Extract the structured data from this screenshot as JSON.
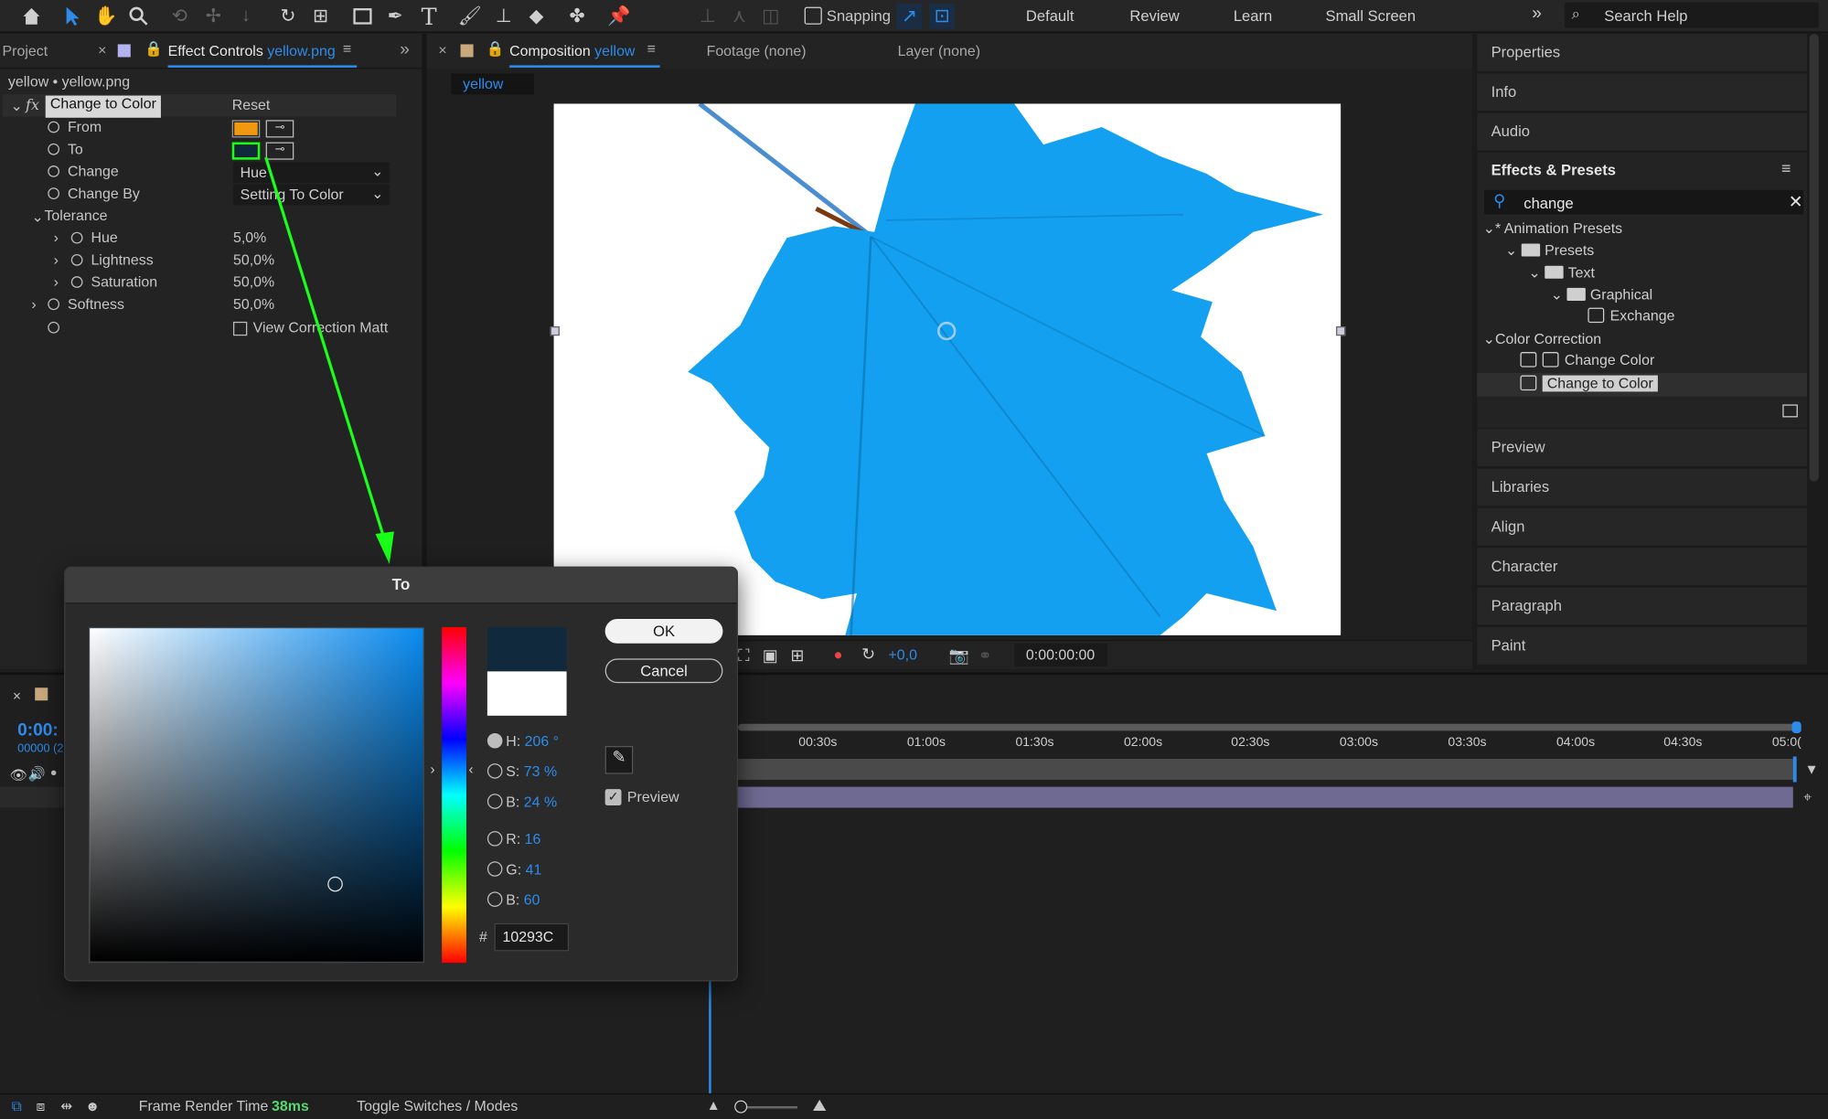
{
  "toolbar": {
    "snapping_label": "Snapping",
    "workspaces": [
      "Default",
      "Review",
      "Learn",
      "Small Screen"
    ],
    "more": "»",
    "search_placeholder": "Search Help"
  },
  "left_panel": {
    "tab_project": "Project",
    "tab_effect_controls": "Effect Controls",
    "tab_effect_file": "yellow.png",
    "breadcrumb": "yellow • yellow.png",
    "effect_name": "Change to Color",
    "reset": "Reset",
    "props": {
      "from": "From",
      "to": "To",
      "change": "Change",
      "change_value": "Hue",
      "change_by": "Change By",
      "change_by_value": "Setting To Color",
      "tolerance": "Tolerance",
      "hue": "Hue",
      "hue_value": "5,0%",
      "lightness": "Lightness",
      "lightness_value": "50,0%",
      "saturation": "Saturation",
      "saturation_value": "50,0%",
      "softness": "Softness",
      "softness_value": "50,0%",
      "view_correction": "View Correction Matt"
    },
    "colors": {
      "from": "#f0980f",
      "to": "#10293c"
    }
  },
  "comp_panel": {
    "tab_composition": "Composition",
    "tab_comp_name": "yellow",
    "tab_footage": "Footage (none)",
    "tab_layer": "Layer (none)",
    "comp_chip": "yellow",
    "exposure": "+0,0",
    "timecode": "0:00:00:00"
  },
  "right_panel": {
    "properties": "Properties",
    "info": "Info",
    "audio": "Audio",
    "effects_presets": "Effects & Presets",
    "search_value": "change",
    "tree": {
      "animation_presets": "* Animation Presets",
      "presets": "Presets",
      "text": "Text",
      "graphical": "Graphical",
      "exchange": "Exchange",
      "color_correction": "Color Correction",
      "change_color": "Change Color",
      "change_to_color": "Change to Color"
    },
    "collapsed": [
      "Preview",
      "Libraries",
      "Align",
      "Character",
      "Paragraph",
      "Paint"
    ]
  },
  "dialog": {
    "title": "To",
    "ok": "OK",
    "cancel": "Cancel",
    "preview": "Preview",
    "h_label": "H:",
    "h_value": "206",
    "h_unit": "°",
    "s_label": "S:",
    "s_value": "73",
    "s_unit": "%",
    "b_label": "B:",
    "b_value": "24",
    "b_unit": "%",
    "r_label": "R:",
    "r_value": "16",
    "g_label": "G:",
    "g_value": "41",
    "bl_label": "B:",
    "bl_value": "60",
    "hash": "#",
    "hex": "10293C",
    "new_color": "#10293c",
    "old_color": "#ffffff",
    "hue_color": "#0a8bf0"
  },
  "timeline": {
    "timecode": "0:00:",
    "frames": "00000 (2",
    "ticks": [
      "00:30s",
      "01:00s",
      "01:30s",
      "02:00s",
      "02:30s",
      "03:00s",
      "03:30s",
      "04:00s",
      "04:30s",
      "05:0("
    ]
  },
  "statusbar": {
    "render_label": "Frame Render Time",
    "render_value": "38ms",
    "toggle": "Toggle Switches / Modes"
  }
}
